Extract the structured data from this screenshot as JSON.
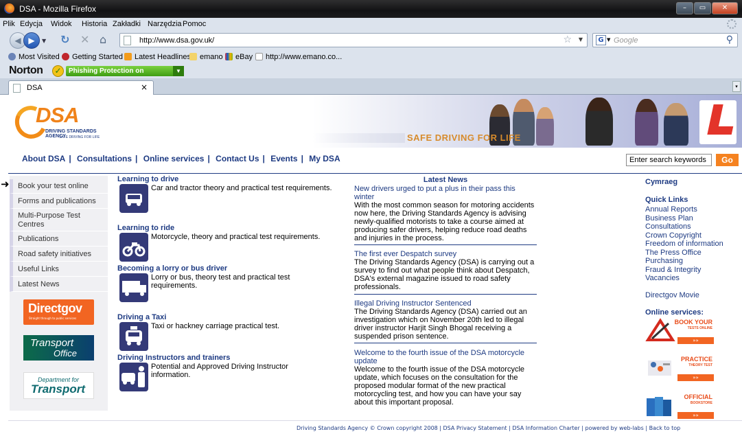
{
  "browser": {
    "window_title": "DSA - Mozilla Firefox",
    "menu": [
      "Plik",
      "Edycja",
      "Widok",
      "Historia",
      "Zakładki",
      "Narzędzia",
      "Pomoc"
    ],
    "url": "http://www.dsa.gov.uk/",
    "search_placeholder": "Google",
    "bookmarks": [
      "Most Visited",
      "Getting Started",
      "Latest Headlines",
      "emano",
      "eBay",
      "http://www.emano.co..."
    ],
    "norton_label": "Norton",
    "phishing_label": "Phishing Protection on",
    "tab_title": "DSA"
  },
  "site": {
    "logo_text": "DSA",
    "logo_sub": "DRIVING STANDARDS AGENCY",
    "logo_sub2": "SAFE DRIVING FOR LIFE",
    "banner_tagline": "SAFE DRIVING FOR LIFE",
    "topnav": [
      "About DSA",
      "Consultations",
      "Online services",
      "Contact Us",
      "Events",
      "My DSA"
    ],
    "search_placeholder": "Enter search keywords",
    "go_label": "Go",
    "leftnav": [
      "Book your test online",
      "Forms and publications",
      "Multi-Purpose Test Centres",
      "Publications",
      "Road safety initiatives",
      "Useful Links",
      "Latest News"
    ],
    "partners": {
      "directgov": "Directgov",
      "directgov_sub": "Straight through to public services",
      "transport_1": "Transport",
      "transport_2": "Office",
      "dft_1": "Department for",
      "dft_2": "Transport"
    },
    "services": [
      {
        "title": "Learning to drive",
        "desc": "Car and tractor theory and practical test requirements.",
        "icon": "car-icon"
      },
      {
        "title": "Learning to ride",
        "desc": "Motorcycle, theory and practical test requirements.",
        "icon": "motorcycle-icon"
      },
      {
        "title": "Becoming a lorry or bus driver",
        "desc": "Lorry or bus, theory test and practical test requirements.",
        "icon": "lorry-icon"
      },
      {
        "title": "Driving a Taxi",
        "desc": "Taxi or hackney carriage practical test.",
        "icon": "taxi-icon"
      },
      {
        "title": "Driving Instructors and trainers",
        "desc": "Potential and Approved Driving Instructor information.",
        "icon": "instructor-icon"
      }
    ],
    "news_heading": "Latest News",
    "news": [
      {
        "headline": "New drivers urged to put a plus in their pass this winter",
        "body": "With the most common season for motoring accidents now here, the Driving Standards Agency is advising newly-qualified motorists to take a course aimed at producing safer drivers, helping reduce road deaths and injuries in the process."
      },
      {
        "headline": "The first ever Despatch survey",
        "body": "The Driving Standards Agency (DSA) is carrying out a survey to find out what people think about Despatch, DSA's external magazine issued to road safety professionals."
      },
      {
        "headline": "Illegal Driving Instructor Sentenced",
        "body": "The Driving Standards Agency (DSA) carried out an investigation which on November 20th led to illegal driver instructor Harjit Singh Bhogal receiving a suspended prison sentence."
      },
      {
        "headline": "Welcome to the fourth issue of the DSA motorcycle update",
        "body": "Welcome to the fourth issue of the DSA motorcycle update, which focuses on the consultation for the proposed modular format of the new practical motorcycling test, and how you can have your say about this important proposal."
      }
    ],
    "cymraeg": "Cymraeg",
    "quick_links_heading": "Quick Links",
    "quick_links": [
      "Annual Reports",
      "Business Plan",
      "Consultations",
      "Crown Copyright",
      "Freedom of information",
      "The Press Office",
      "Purchasing",
      "Fraud & Integrity",
      "Vacancies"
    ],
    "directgov_movie": "Directgov Movie",
    "online_services_heading": "Online services:",
    "promos": [
      {
        "head": "BOOK YOUR",
        "sub": "TESTS ONLINE",
        "more": "»»"
      },
      {
        "head": "PRACTICE",
        "sub": "THEORY TEST",
        "more": "»»"
      },
      {
        "head": "OFFICIAL",
        "sub": "BOOKSTORE",
        "more": "»»"
      }
    ],
    "footer": "Driving Standards Agency © Crown copyright 2008 | DSA Privacy Statement | DSA Information Charter | powered by web-labs | Back to top"
  }
}
